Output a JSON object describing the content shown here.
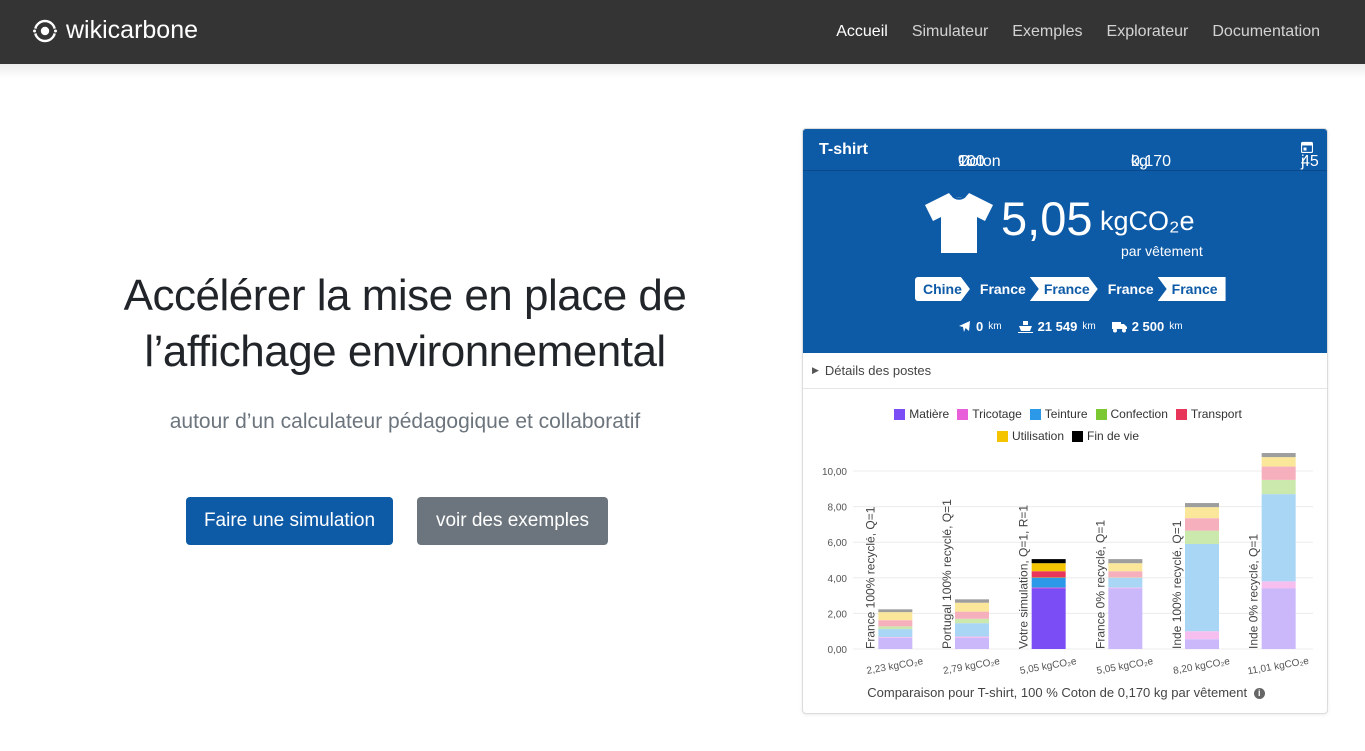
{
  "nav": {
    "brand": "wikicarbone",
    "links": [
      "Accueil",
      "Simulateur",
      "Exemples",
      "Explorateur",
      "Documentation"
    ],
    "active": "Accueil"
  },
  "hero": {
    "title_line1": "Accélérer la mise en place de",
    "title_line2": "l’affichage environnemental",
    "subtitle": "autour d’un calculateur pédagogique et collaboratif",
    "primary_button": "Faire une simulation",
    "secondary_button": "voir des exemples"
  },
  "card": {
    "product": "T-shirt",
    "material_pct": "100",
    "material_pct_unit": "%",
    "material": "Coton",
    "mass": "0,170",
    "mass_unit": "kg",
    "days": "45",
    "days_unit": "j",
    "score": "5,05",
    "score_unit": "kgCO₂e",
    "per": "par vêtement",
    "steps": [
      "Chine",
      "France",
      "France",
      "France",
      "France"
    ],
    "transport": {
      "air": "0",
      "air_unit": "km",
      "sea": "21 549",
      "sea_unit": "km",
      "road": "2 500",
      "road_unit": "km"
    },
    "details_label": "Détails des postes",
    "caption": "Comparaison pour T-shirt, 100 % Coton de 0,170 kg par vêtement"
  },
  "chart_data": {
    "type": "bar",
    "stacked": true,
    "categories": [
      "France 100% recyclé, Q=1",
      "Portugal 100% recyclé, Q=1",
      "Votre simulation, Q=1, R=1",
      "France 0% recyclé, Q=1",
      "Inde 100% recyclé, Q=1",
      "Inde 0% recyclé, Q=1"
    ],
    "totals_labels": [
      "2,23 kgCO₂e",
      "2,79 kgCO₂e",
      "5,05 kgCO₂e",
      "5,05 kgCO₂e",
      "8,20 kgCO₂e",
      "11,01 kgCO₂e"
    ],
    "highlight_index": 2,
    "series": [
      {
        "name": "Matière",
        "color": "#7b4df5",
        "values": [
          0.62,
          0.62,
          3.4,
          3.4,
          0.55,
          3.4
        ]
      },
      {
        "name": "Tricotage",
        "color": "#e85fd9",
        "values": [
          0.05,
          0.08,
          0.05,
          0.05,
          0.45,
          0.4
        ]
      },
      {
        "name": "Teinture",
        "color": "#2b98e8",
        "values": [
          0.45,
          0.75,
          0.55,
          0.55,
          4.9,
          4.9
        ]
      },
      {
        "name": "Confection",
        "color": "#7cc832",
        "values": [
          0.15,
          0.25,
          0.02,
          0.02,
          0.75,
          0.8
        ]
      },
      {
        "name": "Transport",
        "color": "#e8365a",
        "values": [
          0.35,
          0.4,
          0.35,
          0.35,
          0.7,
          0.75
        ]
      },
      {
        "name": "Utilisation",
        "color": "#f4c400",
        "values": [
          0.45,
          0.5,
          0.45,
          0.45,
          0.62,
          0.53
        ]
      },
      {
        "name": "Fin de vie",
        "color": "#000000",
        "values": [
          0.16,
          0.19,
          0.23,
          0.23,
          0.23,
          0.23
        ]
      }
    ],
    "ylim": [
      0,
      10
    ],
    "yticks": [
      "0,00",
      "2,00",
      "4,00",
      "6,00",
      "8,00",
      "10,00"
    ],
    "ytick_values": [
      0,
      2,
      4,
      6,
      8,
      10
    ],
    "grid": true,
    "legend_position": "top",
    "muted_tail_color": "#9e9e9e"
  }
}
